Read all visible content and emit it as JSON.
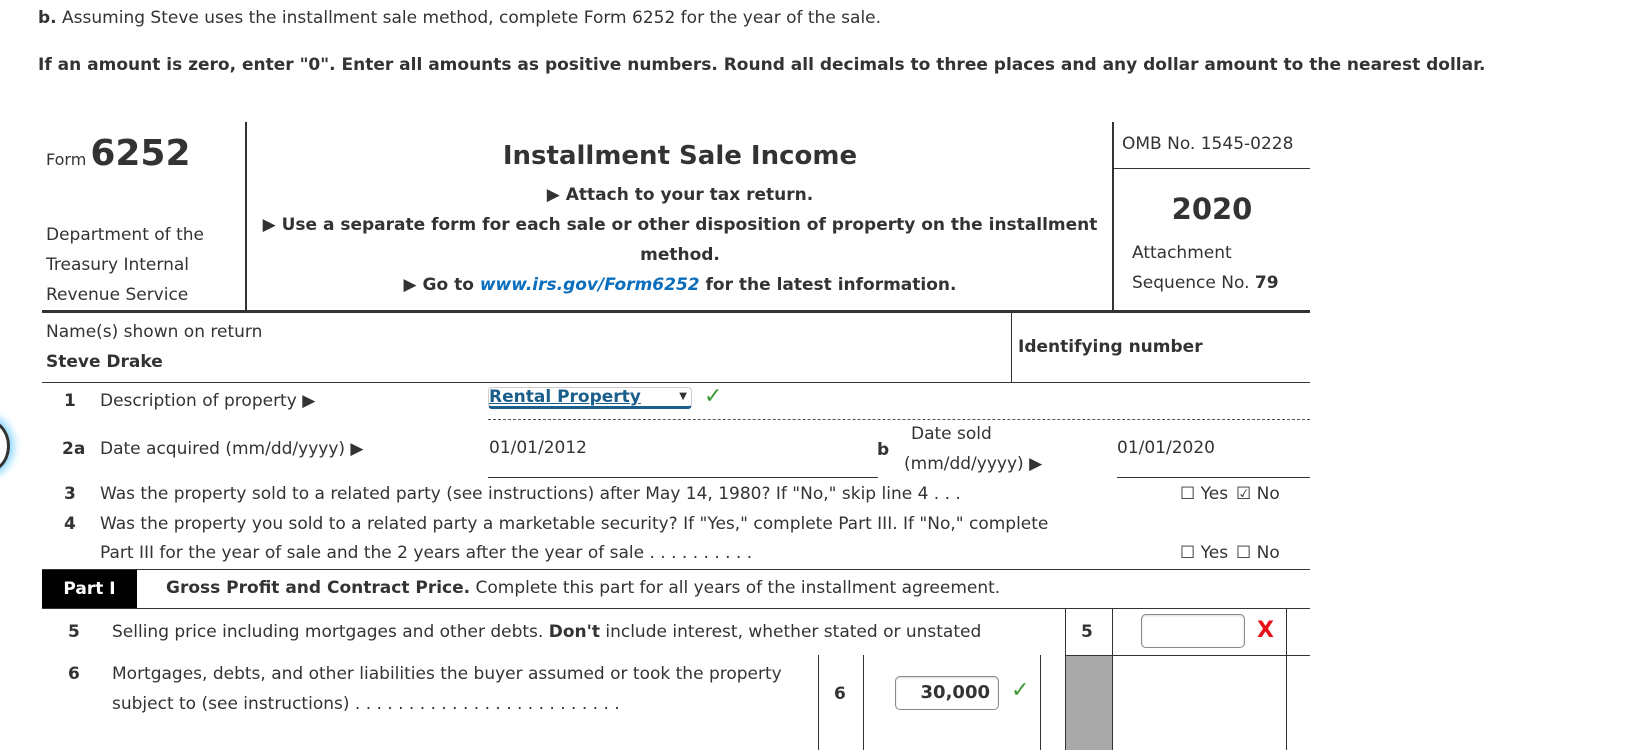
{
  "instructions": {
    "part_label": "b.",
    "question": " Assuming Steve uses the installment sale method, complete Form 6252 for the year of the sale.",
    "rules": "If an amount is zero, enter \"0\". Enter all amounts as positive numbers. Round all decimals to three places and any dollar amount to the nearest dollar."
  },
  "header": {
    "form_word": "Form",
    "form_number": "6252",
    "department": [
      "Department of the",
      "Treasury Internal",
      "Revenue Service"
    ],
    "title": "Installment Sale Income",
    "lines": [
      "▶ Attach to your tax return.",
      "▶ Use a separate form for each sale or other disposition of property on the installment",
      "method."
    ],
    "goto_prefix": "▶ Go to ",
    "goto_link": "www.irs.gov/Form6252",
    "goto_suffix": " for the latest information.",
    "omb": "OMB No. 1545-0228",
    "year": "2020",
    "attachment": "Attachment",
    "sequence_label": "Sequence No. ",
    "sequence_no": "79"
  },
  "taxpayer": {
    "name_label": "Name(s) shown on return",
    "name_value": "Steve Drake",
    "id_label": "Identifying number"
  },
  "lines": {
    "l1": {
      "num": "1",
      "text": "Description of property ▶",
      "value": "Rental Property",
      "status": "correct"
    },
    "l2a": {
      "num": "2a",
      "text": "Date acquired (mm/dd/yyyy) ▶",
      "value": "01/01/2012"
    },
    "l2b": {
      "num": "b",
      "text1": "Date sold",
      "text2": "(mm/dd/yyyy) ▶",
      "value": "01/01/2020"
    },
    "l3": {
      "num": "3",
      "text": "Was the property sold to a related party (see instructions) after May 14, 1980? If \"No,\" skip line 4 . . .",
      "yes": "☐ Yes",
      "no": "☑ No",
      "answer": "No"
    },
    "l4": {
      "num": "4",
      "text1": "Was the property you sold to a related party a marketable security? If \"Yes,\" complete Part III. If \"No,\" complete",
      "text2": "Part III for the year of sale and the 2 years after the year of sale . . . . . . . . . .",
      "yes": "☐ Yes",
      "no": "☐ No"
    }
  },
  "part1": {
    "label": "Part I",
    "title_bold": "Gross Profit and Contract Price.",
    "title_rest": " Complete this part for all years of the installment agreement.",
    "l5": {
      "num": "5",
      "text_a": "Selling price including mortgages and other debts. ",
      "text_bold": "Don't",
      "text_b": " include interest, whether stated or unstated",
      "box": "5",
      "value": "",
      "status": "incorrect"
    },
    "l6": {
      "num": "6",
      "text1": "Mortgages, debts, and other liabilities the buyer assumed or took the property",
      "text2": "subject to (see instructions) . . . . . . . . . . . . . . . . . . . . . . . . .",
      "box": "6",
      "value": "30,000",
      "status": "correct"
    }
  },
  "icons": {
    "check": "✓",
    "x": "X",
    "caret": "▼"
  }
}
